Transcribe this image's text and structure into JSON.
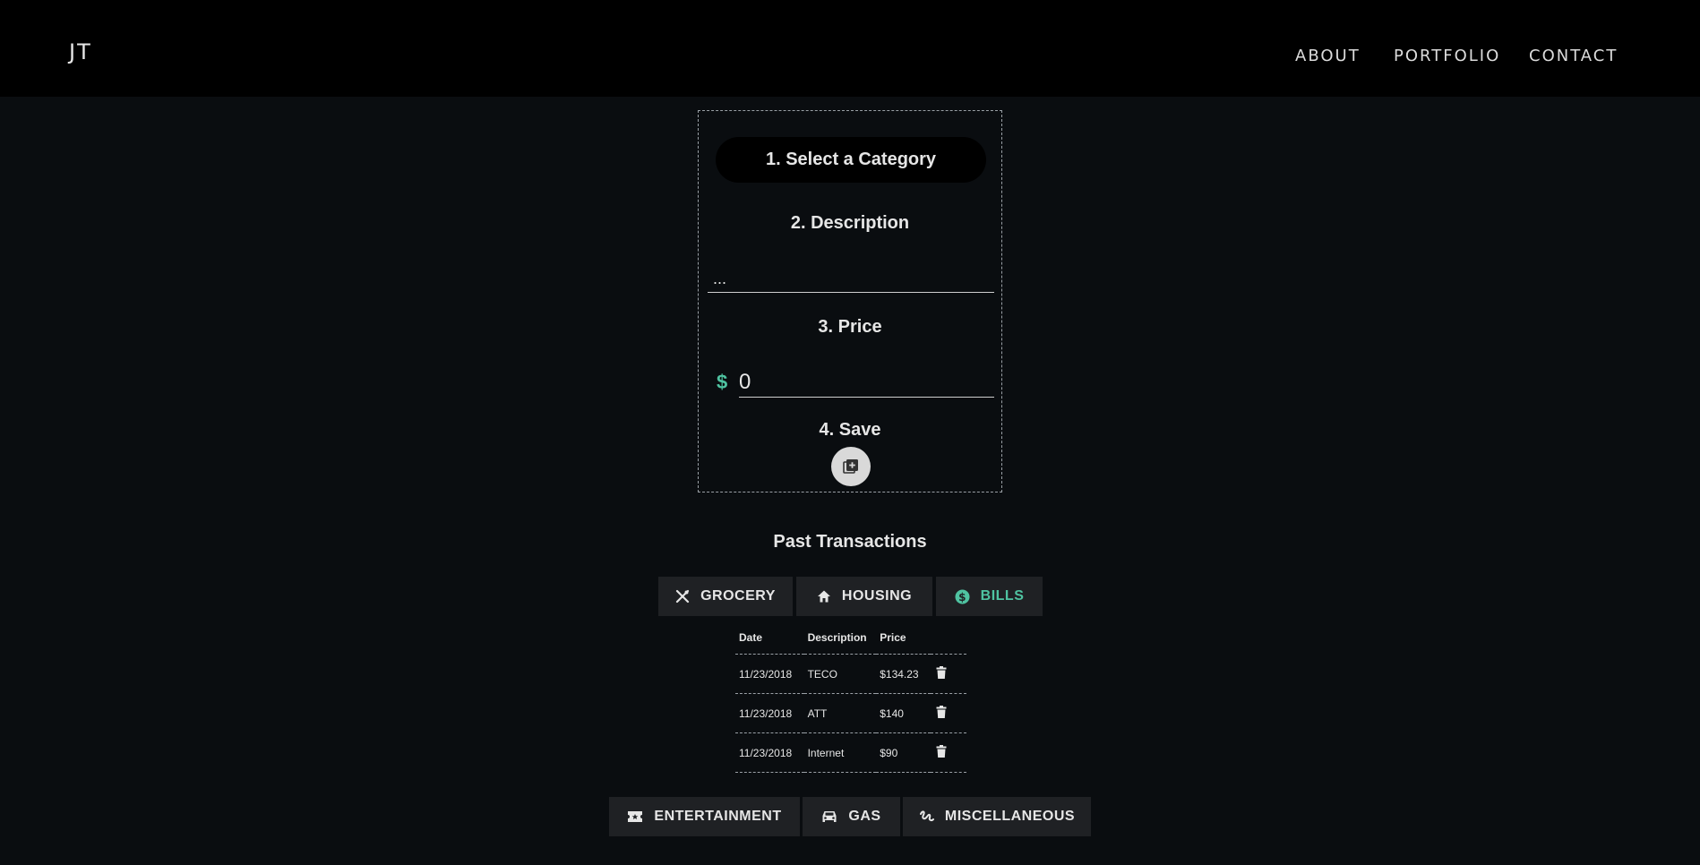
{
  "header": {
    "brand": "JT",
    "nav": [
      "ABOUT",
      "PORTFOLIO",
      "CONTACT"
    ]
  },
  "form": {
    "step1": "1. Select a Category",
    "step2": "2. Description",
    "description_value": "...",
    "step3": "3. Price",
    "currency_symbol": "$",
    "price_value": "0",
    "step4": "4. Save",
    "save_icon": "add-to-library-icon"
  },
  "past": {
    "title": "Past Transactions",
    "tabs_top": [
      {
        "label": "GROCERY",
        "icon": "utensils-icon",
        "active": false
      },
      {
        "label": "HOUSING",
        "icon": "home-icon",
        "active": false
      },
      {
        "label": "BILLS",
        "icon": "dollar-circle-icon",
        "active": true
      }
    ],
    "tabs_bottom": [
      {
        "label": "ENTERTAINMENT",
        "icon": "ticket-icon",
        "active": false
      },
      {
        "label": "GAS",
        "icon": "car-icon",
        "active": false
      },
      {
        "label": "MISCELLANEOUS",
        "icon": "gesture-icon",
        "active": false
      }
    ],
    "table": {
      "headers": [
        "Date",
        "Description",
        "Price"
      ],
      "rows": [
        [
          "11/23/2018",
          "TECO",
          "$134.23"
        ],
        [
          "11/23/2018",
          "ATT",
          "$140"
        ],
        [
          "11/23/2018",
          "Internet",
          "$90"
        ]
      ]
    }
  },
  "colors": {
    "accent": "#4fc3a1",
    "background": "#0a0d10",
    "topbar": "#000000",
    "tab_bg": "#1f2124"
  }
}
